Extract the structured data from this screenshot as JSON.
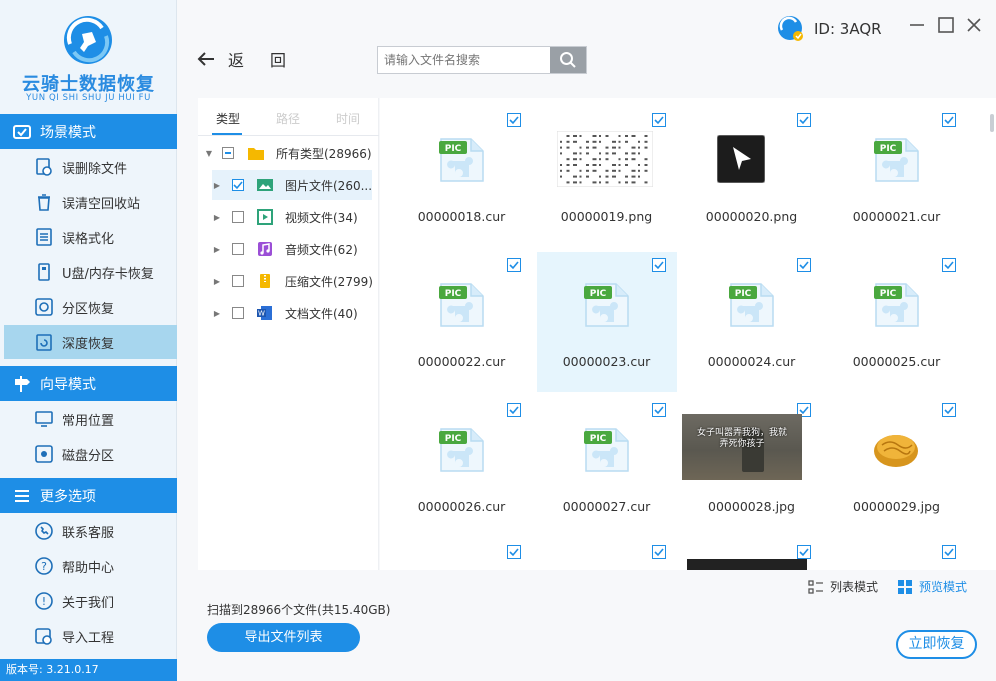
{
  "app": {
    "logo_text": "云骑士数据恢复",
    "logo_sub": "YUN QI SHI SHU JU HUI FU",
    "user_id": "ID: 3AQR",
    "version": "版本号: 3.21.0.17"
  },
  "sidebar": {
    "sections": [
      {
        "title": "场景模式",
        "items": [
          "误删除文件",
          "误清空回收站",
          "误格式化",
          "U盘/内存卡恢复",
          "分区恢复",
          "深度恢复"
        ]
      },
      {
        "title": "向导模式",
        "items": [
          "常用位置",
          "磁盘分区"
        ]
      },
      {
        "title": "更多选项",
        "items": [
          "联系客服",
          "帮助中心",
          "关于我们",
          "导入工程"
        ]
      }
    ]
  },
  "topbar": {
    "back_label_1": "返",
    "back_label_2": "回",
    "search_placeholder": "请输入文件名搜索"
  },
  "tree": {
    "tabs": [
      "类型",
      "路径",
      "时间"
    ],
    "rows": [
      {
        "label": "所有类型(28966)",
        "icon": "folder-icon"
      },
      {
        "label": "图片文件(260...",
        "icon": "image-icon"
      },
      {
        "label": "视频文件(34)",
        "icon": "video-icon"
      },
      {
        "label": "音频文件(62)",
        "icon": "audio-icon"
      },
      {
        "label": "压缩文件(2799)",
        "icon": "zip-icon"
      },
      {
        "label": "文档文件(40)",
        "icon": "doc-icon"
      }
    ]
  },
  "files": [
    {
      "name": "00000018.cur",
      "kind": "pic"
    },
    {
      "name": "00000019.png",
      "kind": "doc-thumb"
    },
    {
      "name": "00000020.png",
      "kind": "cursor-thumb"
    },
    {
      "name": "00000021.cur",
      "kind": "pic"
    },
    {
      "name": "00000022.cur",
      "kind": "pic"
    },
    {
      "name": "00000023.cur",
      "kind": "pic"
    },
    {
      "name": "00000024.cur",
      "kind": "pic"
    },
    {
      "name": "00000025.cur",
      "kind": "pic"
    },
    {
      "name": "00000026.cur",
      "kind": "pic"
    },
    {
      "name": "00000027.cur",
      "kind": "pic"
    },
    {
      "name": "00000028.jpg",
      "kind": "photo-thumb",
      "caption_1": "女子叫嚣弄我狗，我就",
      "caption_2": "弄死你孩子"
    },
    {
      "name": "00000029.jpg",
      "kind": "bread-thumb"
    }
  ],
  "footer": {
    "list_mode": "列表模式",
    "preview_mode": "预览模式",
    "scan_info": "扫描到28966个文件(共15.40GB)",
    "export_button": "导出文件列表",
    "recover_button": "立即恢复"
  },
  "colors": {
    "accent": "#1e8ee6",
    "highlight": "#a7d6ee"
  }
}
